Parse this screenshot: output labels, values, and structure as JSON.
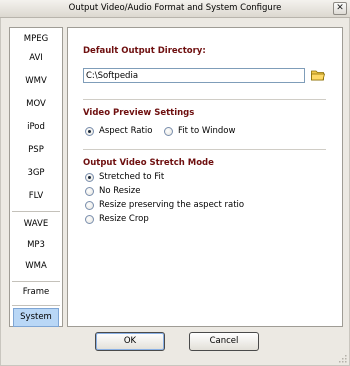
{
  "window": {
    "title": "Output Video/Audio Format and System Configure"
  },
  "sidebar": {
    "items": [
      {
        "label": "MPEG"
      },
      {
        "label": "AVI"
      },
      {
        "label": "WMV"
      },
      {
        "label": "MOV"
      },
      {
        "label": "iPod"
      },
      {
        "label": "PSP"
      },
      {
        "label": "3GP"
      },
      {
        "label": "FLV"
      },
      {
        "label": "WAVE"
      },
      {
        "label": "MP3"
      },
      {
        "label": "WMA"
      },
      {
        "label": "Frame"
      },
      {
        "label": "System",
        "active": true
      }
    ]
  },
  "output_dir": {
    "title": "Default Output Directory:",
    "value": "C:\\Softpedia"
  },
  "preview": {
    "title": "Video Preview Settings",
    "options": [
      {
        "label": "Aspect Ratio",
        "checked": true
      },
      {
        "label": "Fit to Window",
        "checked": false
      }
    ]
  },
  "stretch": {
    "title": "Output Video Stretch Mode",
    "options": [
      {
        "label": "Stretched to Fit",
        "checked": true
      },
      {
        "label": "No Resize",
        "checked": false
      },
      {
        "label": "Resize preserving the aspect ratio",
        "checked": false
      },
      {
        "label": "Resize Crop",
        "checked": false
      }
    ]
  },
  "buttons": {
    "ok": "OK",
    "cancel": "Cancel"
  },
  "colors": {
    "section_title": "#6e0f0f",
    "active_item": "#b9d7f6",
    "folder": "#e6b800"
  }
}
